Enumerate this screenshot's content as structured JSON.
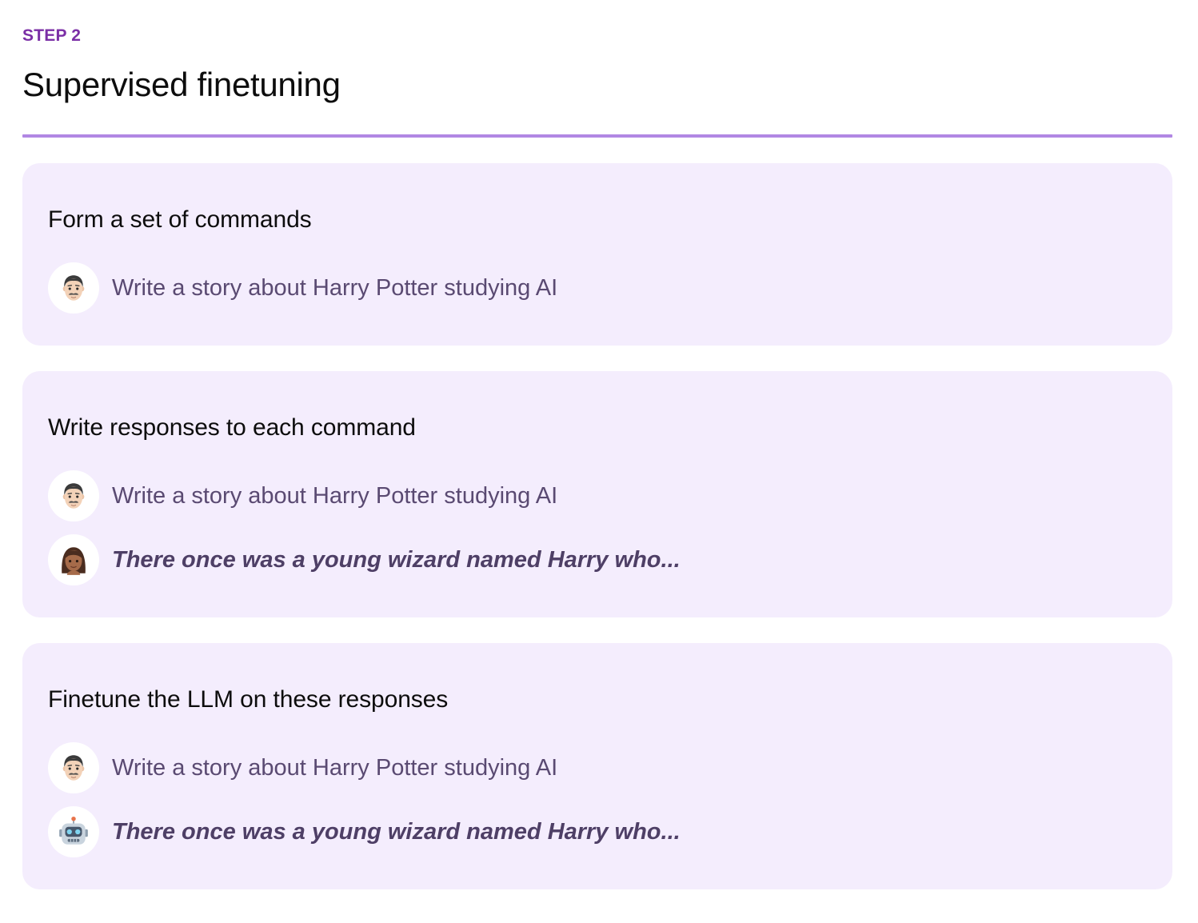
{
  "header": {
    "step_label": "STEP 2",
    "title": "Supervised finetuning"
  },
  "cards": [
    {
      "title": "Form a set of commands",
      "messages": [
        {
          "avatar": "man-icon",
          "text": "Write a story about Harry Potter studying AI"
        }
      ]
    },
    {
      "title": "Write responses to each command",
      "messages": [
        {
          "avatar": "man-icon",
          "text": "Write a story about Harry Potter studying AI"
        },
        {
          "avatar": "woman-icon",
          "text": "There once was a young wizard named Harry who..."
        }
      ]
    },
    {
      "title": "Finetune the LLM on these responses",
      "messages": [
        {
          "avatar": "man-icon",
          "text": "Write a story about Harry Potter studying AI"
        },
        {
          "avatar": "robot-icon",
          "text": "There once was a young wizard named Harry who..."
        }
      ]
    }
  ],
  "colors": {
    "accent": "#7b2fa6",
    "divider": "#b187e3",
    "card_background": "#f4edfd"
  }
}
